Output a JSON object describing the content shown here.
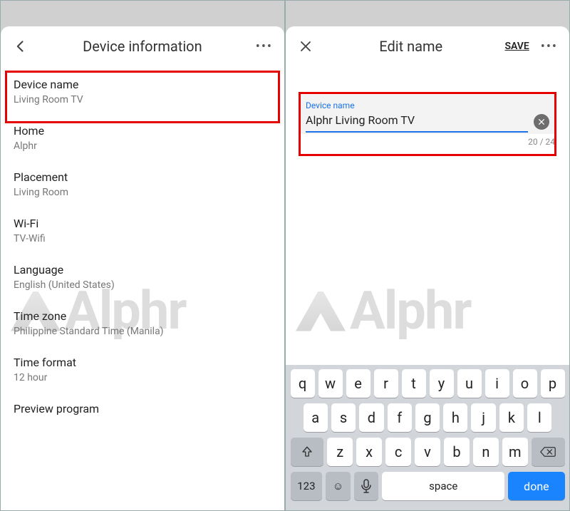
{
  "left": {
    "title": "Device information",
    "items": [
      {
        "label": "Device name",
        "value": "Living Room TV"
      },
      {
        "label": "Home",
        "value": "Alphr"
      },
      {
        "label": "Placement",
        "value": "Living Room"
      },
      {
        "label": "Wi-Fi",
        "value": "TV-Wifi"
      },
      {
        "label": "Language",
        "value": "English (United States)"
      },
      {
        "label": "Time zone",
        "value": "Philippine Standard Time (Manila)"
      },
      {
        "label": "Time format",
        "value": "12 hour"
      },
      {
        "label": "Preview program",
        "value": ""
      }
    ]
  },
  "right": {
    "title": "Edit name",
    "save": "SAVE",
    "field_label": "Device name",
    "field_value": "Alphr Living Room TV",
    "counter": "20 / 24"
  },
  "keyboard": {
    "row1": [
      "q",
      "w",
      "e",
      "r",
      "t",
      "y",
      "u",
      "i",
      "o",
      "p"
    ],
    "row2": [
      "a",
      "s",
      "d",
      "f",
      "g",
      "h",
      "j",
      "k",
      "l"
    ],
    "row3": [
      "z",
      "x",
      "c",
      "v",
      "b",
      "n",
      "m"
    ],
    "num": "123",
    "space": "space",
    "done": "done"
  },
  "watermark": "Alphr"
}
